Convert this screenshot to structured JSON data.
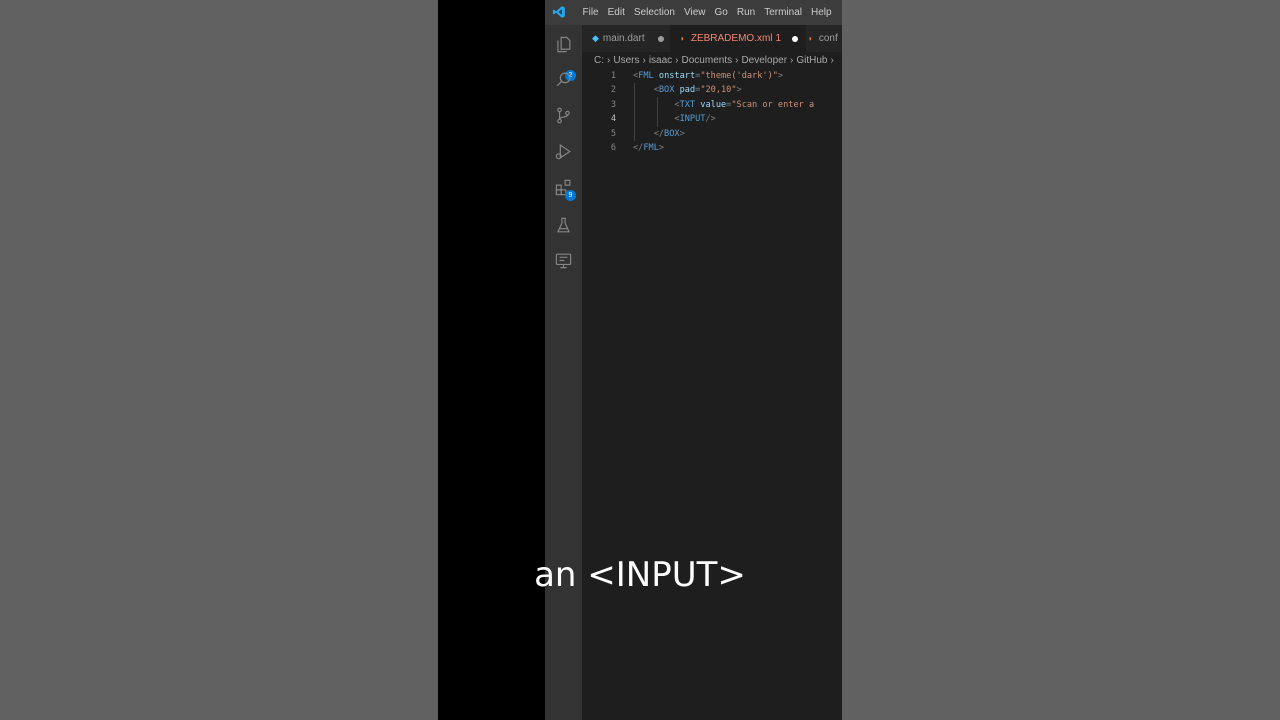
{
  "menu": [
    "File",
    "Edit",
    "Selection",
    "View",
    "Go",
    "Run",
    "Terminal",
    "Help"
  ],
  "activity_bar": {
    "explorer_badge": "2",
    "extensions_badge": "9",
    "icons": [
      "files-icon",
      "search-icon",
      "source-control-icon",
      "run-debug-icon",
      "extensions-icon",
      "testing-icon",
      "remote-explorer-icon"
    ]
  },
  "tabs": [
    {
      "label": "main.dart",
      "icon": "dart-icon",
      "modified": true,
      "active": false,
      "color": "#cccccc"
    },
    {
      "label": "ZEBRADEMO.xml",
      "problems": "1",
      "icon": "rss-icon",
      "modified": true,
      "active": true,
      "color": "#f48771"
    },
    {
      "label": "conf",
      "icon": "rss-icon",
      "modified": false,
      "active": false,
      "color": "#cccccc"
    }
  ],
  "breadcrumb": [
    "C:",
    "Users",
    "isaac",
    "Documents",
    "Developer",
    "GitHub"
  ],
  "editor": {
    "current_line": 4,
    "lines": [
      {
        "num": "1",
        "tokens": [
          {
            "t": "<",
            "c": "br"
          },
          {
            "t": "FML",
            "c": "tag"
          },
          {
            "t": " ",
            "c": "br"
          },
          {
            "t": "onstart",
            "c": "attr"
          },
          {
            "t": "=",
            "c": "br"
          },
          {
            "t": "\"theme('dark')\"",
            "c": "str"
          },
          {
            "t": ">",
            "c": "br"
          }
        ]
      },
      {
        "num": "2",
        "tokens": [
          {
            "t": "    <",
            "c": "br"
          },
          {
            "t": "BOX",
            "c": "tag"
          },
          {
            "t": " ",
            "c": "br"
          },
          {
            "t": "pad",
            "c": "attr"
          },
          {
            "t": "=",
            "c": "br"
          },
          {
            "t": "\"20,10\"",
            "c": "str"
          },
          {
            "t": ">",
            "c": "br"
          }
        ]
      },
      {
        "num": "3",
        "tokens": [
          {
            "t": "        <",
            "c": "br"
          },
          {
            "t": "TXT",
            "c": "tag"
          },
          {
            "t": " ",
            "c": "br"
          },
          {
            "t": "value",
            "c": "attr"
          },
          {
            "t": "=",
            "c": "br"
          },
          {
            "t": "\"Scan or enter a",
            "c": "str"
          }
        ]
      },
      {
        "num": "4",
        "tokens": [
          {
            "t": "        <",
            "c": "br"
          },
          {
            "t": "INPUT",
            "c": "tag"
          },
          {
            "t": "/>",
            "c": "br"
          }
        ]
      },
      {
        "num": "5",
        "tokens": [
          {
            "t": "    </",
            "c": "br"
          },
          {
            "t": "BOX",
            "c": "tag"
          },
          {
            "t": ">",
            "c": "br"
          }
        ]
      },
      {
        "num": "6",
        "tokens": [
          {
            "t": "</",
            "c": "br"
          },
          {
            "t": "FML",
            "c": "tag"
          },
          {
            "t": ">",
            "c": "br"
          }
        ]
      }
    ]
  },
  "caption": "an <INPUT>",
  "colors": {
    "accent": "#0078d4",
    "tag": "#569cd6",
    "attribute": "#9cdcfe",
    "string": "#ce9178",
    "modified_tab": "#f48771"
  }
}
